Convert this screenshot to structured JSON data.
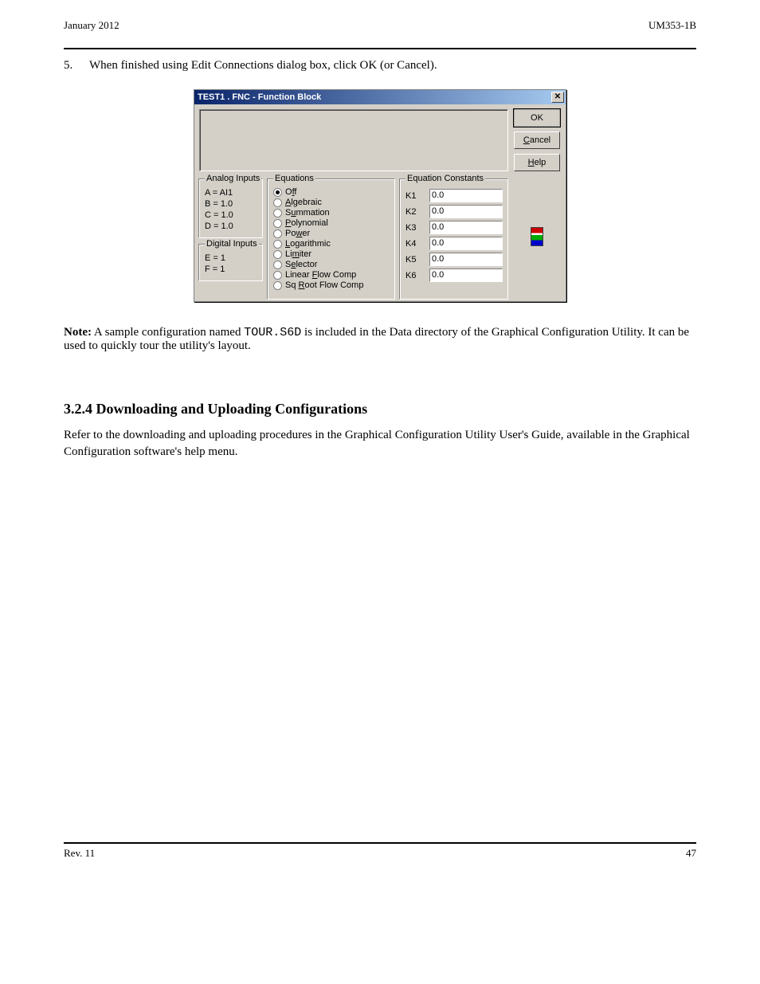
{
  "header": {
    "left": "January 2012",
    "right": "UM353-1B"
  },
  "footer": {
    "left": "Rev. 11",
    "right": "47"
  },
  "dialog": {
    "title": "TEST1 . FNC - Function Block",
    "buttons": {
      "ok": "OK",
      "cancel": "Cancel",
      "help": "Help"
    },
    "analog_legend": "Analog Inputs",
    "digital_legend": "Digital Inputs",
    "equations_legend": "Equations",
    "constants_legend": "Equation Constants",
    "analog_inputs": [
      "A = AI1",
      "B = 1.0",
      "C = 1.0",
      "D = 1.0"
    ],
    "digital_inputs": [
      "E = 1",
      "F = 1"
    ],
    "equations": [
      {
        "label_pre": "O",
        "label_u": "f",
        "label_post": "f",
        "checked": true
      },
      {
        "label_pre": "",
        "label_u": "A",
        "label_post": "lgebraic",
        "checked": false
      },
      {
        "label_pre": "S",
        "label_u": "u",
        "label_post": "mmation",
        "checked": false
      },
      {
        "label_pre": "",
        "label_u": "P",
        "label_post": "olynomial",
        "checked": false
      },
      {
        "label_pre": "Po",
        "label_u": "w",
        "label_post": "er",
        "checked": false
      },
      {
        "label_pre": "",
        "label_u": "L",
        "label_post": "ogarithmic",
        "checked": false
      },
      {
        "label_pre": "Li",
        "label_u": "m",
        "label_post": "iter",
        "checked": false
      },
      {
        "label_pre": "S",
        "label_u": "e",
        "label_post": "lector",
        "checked": false
      },
      {
        "label_pre": "Linear ",
        "label_u": "F",
        "label_post": "low Comp",
        "checked": false
      },
      {
        "label_pre": "Sq ",
        "label_u": "R",
        "label_post": "oot Flow Comp",
        "checked": false
      }
    ],
    "constants": [
      {
        "label": "K1",
        "value": "0.0"
      },
      {
        "label": "K2",
        "value": "0.0"
      },
      {
        "label": "K3",
        "value": "0.0"
      },
      {
        "label": "K4",
        "value": "0.0"
      },
      {
        "label": "K5",
        "value": "0.0"
      },
      {
        "label": "K6",
        "value": "0.0"
      }
    ]
  },
  "section": {
    "title": "3.2.4 Downloading and Uploading Configurations",
    "para1": "Refer to the downloading and uploading procedures in the Graphical Configuration Utility User's Guide, available in the Graphical Configuration software's help menu.",
    "note_label": "Note:",
    "note_body": "A sample configuration named ",
    "note_file": "TOUR.S6D",
    "note_tail": " is included in the Data directory of the Graphical Configuration Utility. It can be used to quickly tour the utility's layout.",
    "step_num": "5.",
    "step_text": "When finished using Edit Connections dialog box, click OK (or Cancel)."
  }
}
